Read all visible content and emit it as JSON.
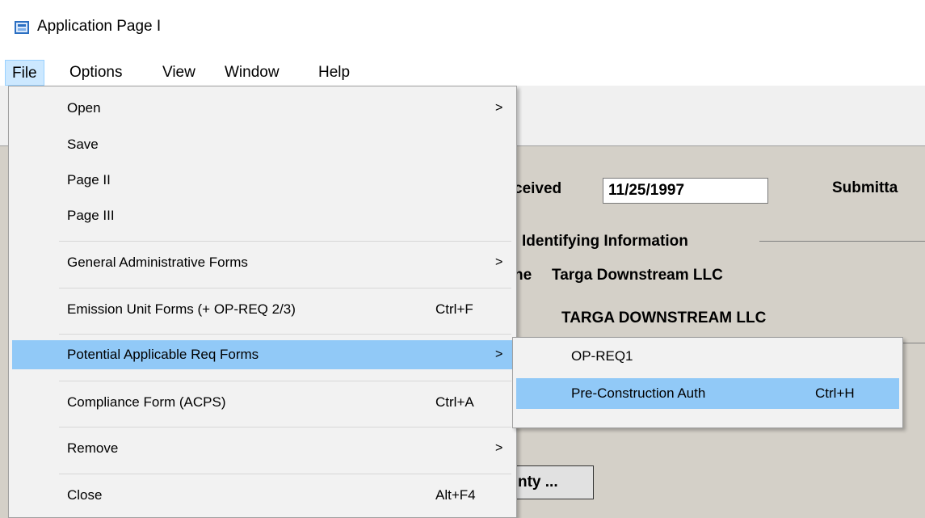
{
  "window": {
    "title": "Application Page I"
  },
  "menubar": {
    "items": [
      {
        "label": "File"
      },
      {
        "label": "Options"
      },
      {
        "label": "View"
      },
      {
        "label": "Window"
      },
      {
        "label": "Help"
      }
    ]
  },
  "form": {
    "received_label": "ceived",
    "received_date": "11/25/1997",
    "submittal_label": "Submitta",
    "identifying_label": "Identifying Information",
    "name_label": "ne",
    "name_value": "Targa Downstream LLC",
    "name_upper": "TARGA DOWNSTREAM LLC",
    "county_button": "nty ..."
  },
  "file_menu": {
    "items": [
      {
        "label": "Open",
        "shortcut": "",
        "arrow": ">"
      },
      {
        "label": "Save",
        "shortcut": "",
        "arrow": ""
      },
      {
        "label": "Page II",
        "shortcut": "",
        "arrow": ""
      },
      {
        "label": "Page III",
        "shortcut": "",
        "arrow": ""
      },
      {
        "label": "General Administrative Forms",
        "shortcut": "",
        "arrow": ">"
      },
      {
        "label": "Emission Unit Forms (+ OP-REQ 2/3)",
        "shortcut": "Ctrl+F",
        "arrow": ""
      },
      {
        "label": "Potential Applicable Req Forms",
        "shortcut": "",
        "arrow": ">"
      },
      {
        "label": "Compliance Form (ACPS)",
        "shortcut": "Ctrl+A",
        "arrow": ""
      },
      {
        "label": "Remove",
        "shortcut": "",
        "arrow": ">"
      },
      {
        "label": "Close",
        "shortcut": "Alt+F4",
        "arrow": ""
      }
    ]
  },
  "submenu": {
    "items": [
      {
        "label": "OP-REQ1",
        "shortcut": ""
      },
      {
        "label": "Pre-Construction Auth",
        "shortcut": "Ctrl+H"
      }
    ]
  },
  "colors": {
    "highlight": "#91c9f7",
    "menu_bg": "#f2f2f2",
    "form_bg": "#d4d0c8"
  },
  "icons": [
    "app-window-icon",
    "submenu-arrow-icon"
  ]
}
